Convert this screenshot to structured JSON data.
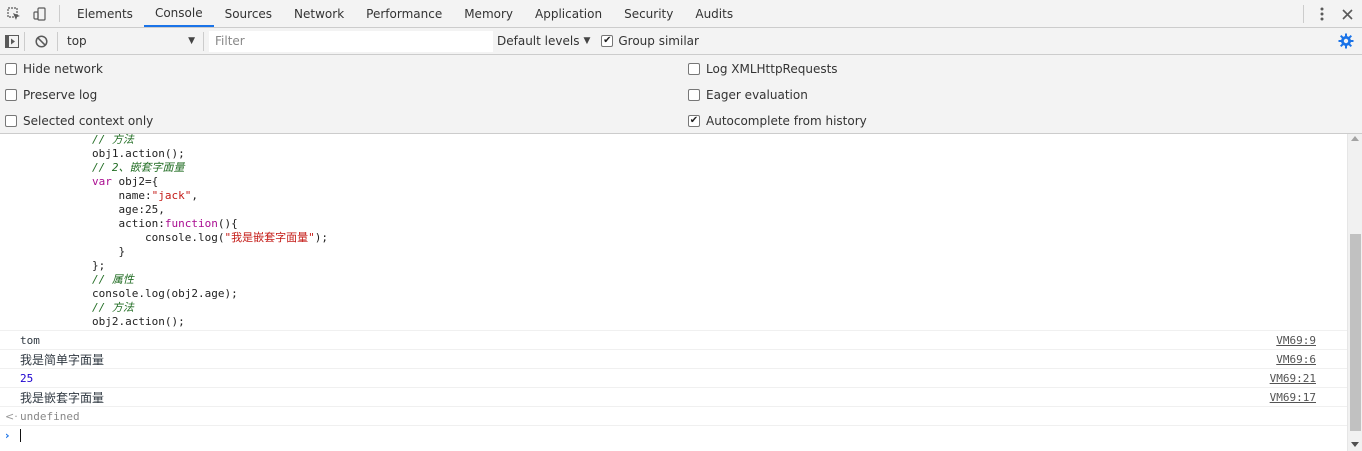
{
  "tabs": [
    {
      "label": "Elements"
    },
    {
      "label": "Console"
    },
    {
      "label": "Sources"
    },
    {
      "label": "Network"
    },
    {
      "label": "Performance"
    },
    {
      "label": "Memory"
    },
    {
      "label": "Application"
    },
    {
      "label": "Security"
    },
    {
      "label": "Audits"
    }
  ],
  "active_tab": "Console",
  "toolbar": {
    "context": "top",
    "filter_placeholder": "Filter",
    "levels": "Default levels",
    "group_similar": "Group similar",
    "group_similar_checked": true
  },
  "settings": {
    "left": [
      {
        "label": "Hide network",
        "checked": false
      },
      {
        "label": "Preserve log",
        "checked": false
      },
      {
        "label": "Selected context only",
        "checked": false
      }
    ],
    "right": [
      {
        "label": "Log XMLHttpRequests",
        "checked": false
      },
      {
        "label": "Eager evaluation",
        "checked": false
      },
      {
        "label": "Autocomplete from history",
        "checked": true
      }
    ]
  },
  "code": {
    "l1": "// 方法",
    "l2": "obj1.action();",
    "l3": "// 2、嵌套字面量",
    "l4_kw": "var",
    "l4_rest": " obj2={",
    "l5_a": "    name:",
    "l5_str": "\"jack\"",
    "l5_b": ",",
    "l6_a": "    age:",
    "l6_num": "25",
    "l6_b": ",",
    "l7_a": "    action:",
    "l7_kw": "function",
    "l7_b": "(){",
    "l8_a": "        console.log(",
    "l8_str": "\"我是嵌套字面量\"",
    "l8_b": ");",
    "l9": "    }",
    "l10": "};",
    "l11": "// 属性",
    "l12": "console.log(obj2.age);",
    "l13": "// 方法",
    "l14": "obj2.action();"
  },
  "logs": [
    {
      "msg": "tom",
      "src": "VM69:9"
    },
    {
      "msg": "我是简单字面量",
      "src": "VM69:6"
    },
    {
      "msg": "25",
      "src": "VM69:21"
    },
    {
      "msg": "我是嵌套字面量",
      "src": "VM69:17"
    }
  ],
  "result": {
    "arrow": "<·",
    "msg": "undefined"
  },
  "prompt": {
    "arrow": "›"
  },
  "colors": {
    "accent": "#1a73e8",
    "comment": "#236e25",
    "keyword": "#aa0d91",
    "string": "#c41a16",
    "number": "#1c00cf"
  }
}
